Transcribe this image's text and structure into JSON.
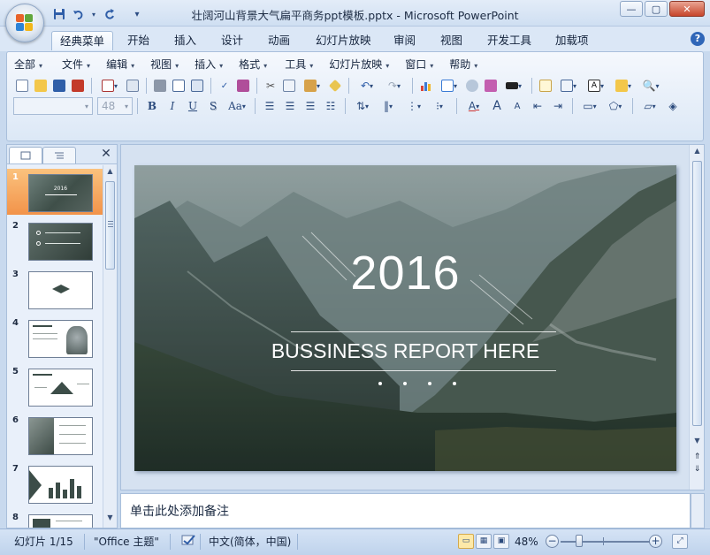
{
  "window": {
    "title": "壮阔河山背景大气扁平商务ppt模板.pptx - Microsoft PowerPoint",
    "controls": {
      "minimize": "—",
      "restore": "▢",
      "close": "✕"
    }
  },
  "quick_access": {
    "save": "💾",
    "undo": "↶",
    "redo": "↻",
    "customize": "▾"
  },
  "ribbon_tabs": [
    "经典菜单",
    "开始",
    "插入",
    "设计",
    "动画",
    "幻灯片放映",
    "审阅",
    "视图",
    "开发工具",
    "加载项"
  ],
  "active_tab": "经典菜单",
  "classic_menu": [
    "全部",
    "文件",
    "编辑",
    "视图",
    "插入",
    "格式",
    "工具",
    "幻灯片放映",
    "窗口",
    "帮助"
  ],
  "format_bar": {
    "font_name": "",
    "font_size": "48",
    "bold": "B",
    "italic": "I",
    "underline": "U",
    "shadow": "S",
    "change_case": "Aa"
  },
  "slide_pane": {
    "tabs": [
      "slides-tab",
      "outline-tab"
    ],
    "close": "✕",
    "thumbnails": [
      {
        "number": "1",
        "selected": true
      },
      {
        "number": "2",
        "selected": false
      },
      {
        "number": "3",
        "selected": false
      },
      {
        "number": "4",
        "selected": false
      },
      {
        "number": "5",
        "selected": false
      },
      {
        "number": "6",
        "selected": false
      },
      {
        "number": "7",
        "selected": false
      },
      {
        "number": "8",
        "selected": false
      }
    ],
    "thumb1_caption": "2016"
  },
  "slide": {
    "title": "2016",
    "subtitle": "BUSSINESS REPORT HERE",
    "dot_count": 4
  },
  "notes": {
    "placeholder": "单击此处添加备注"
  },
  "status_bar": {
    "slide_indicator": "幻灯片 1/15",
    "theme": "\"Office 主题\"",
    "language": "中文(简体，中国)",
    "zoom_percent": "48%",
    "zoom_value": 48
  }
}
